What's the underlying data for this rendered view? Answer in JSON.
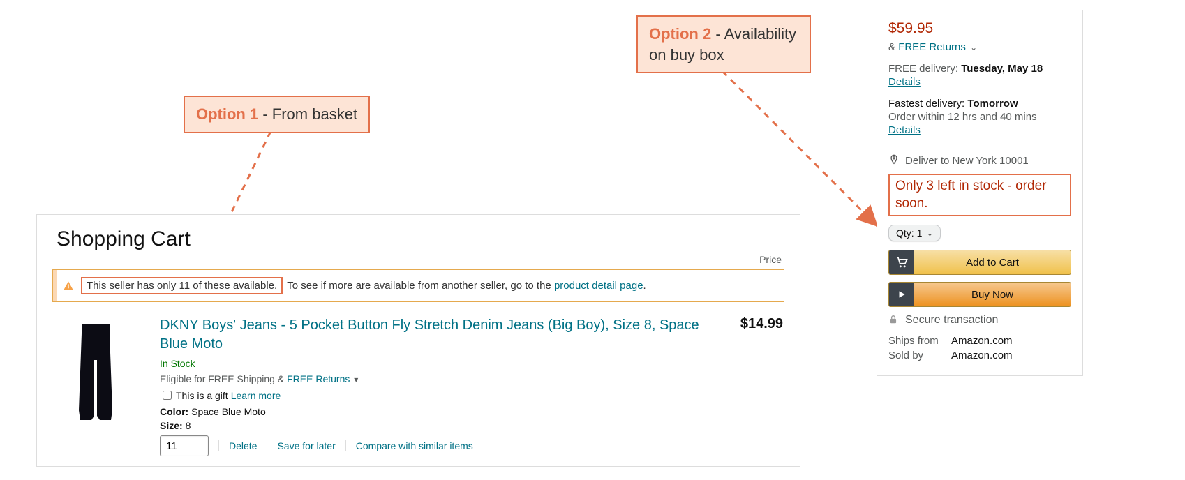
{
  "annotations": {
    "option1": {
      "label": "Option 1",
      "text": "From basket"
    },
    "option2": {
      "label": "Option 2",
      "text": "Availability on buy box"
    }
  },
  "cart": {
    "title": "Shopping Cart",
    "price_column_label": "Price",
    "alert": {
      "availability_text": "This seller has only 11 of these available.",
      "rest_text_prefix": "To see if more are available from another seller, go to the ",
      "link_text": "product detail page",
      "rest_text_suffix": "."
    },
    "item": {
      "title": "DKNY Boys' Jeans - 5 Pocket Button Fly Stretch Denim Jeans (Big Boy), Size 8, Space Blue Moto",
      "price": "$14.99",
      "in_stock": "In Stock",
      "eligible_prefix": "Eligible for FREE Shipping",
      "amp": "&",
      "free_returns": "FREE Returns",
      "gift_label": "This is a gift",
      "gift_learn_more": "Learn more",
      "color_label": "Color:",
      "color_value": "Space Blue Moto",
      "size_label": "Size:",
      "size_value": "8",
      "qty_value": "11",
      "delete": "Delete",
      "save_for_later": "Save for later",
      "compare": "Compare with similar items"
    }
  },
  "buybox": {
    "price": "$59.95",
    "free_returns_prefix": "&",
    "free_returns": "FREE Returns",
    "free_delivery_label": "FREE delivery:",
    "free_delivery_value": "Tuesday, May 18",
    "details": "Details",
    "fastest_label": "Fastest delivery:",
    "fastest_value": "Tomorrow",
    "order_within": "Order within 12 hrs and 40 mins",
    "deliver_to": "Deliver to New York 10001",
    "stock_warning": "Only 3 left in stock - order soon.",
    "qty_label": "Qty:",
    "qty_value": "1",
    "add_to_cart": "Add to Cart",
    "buy_now": "Buy Now",
    "secure": "Secure transaction",
    "ships_from_label": "Ships from",
    "ships_from_value": "Amazon.com",
    "sold_by_label": "Sold by",
    "sold_by_value": "Amazon.com"
  }
}
